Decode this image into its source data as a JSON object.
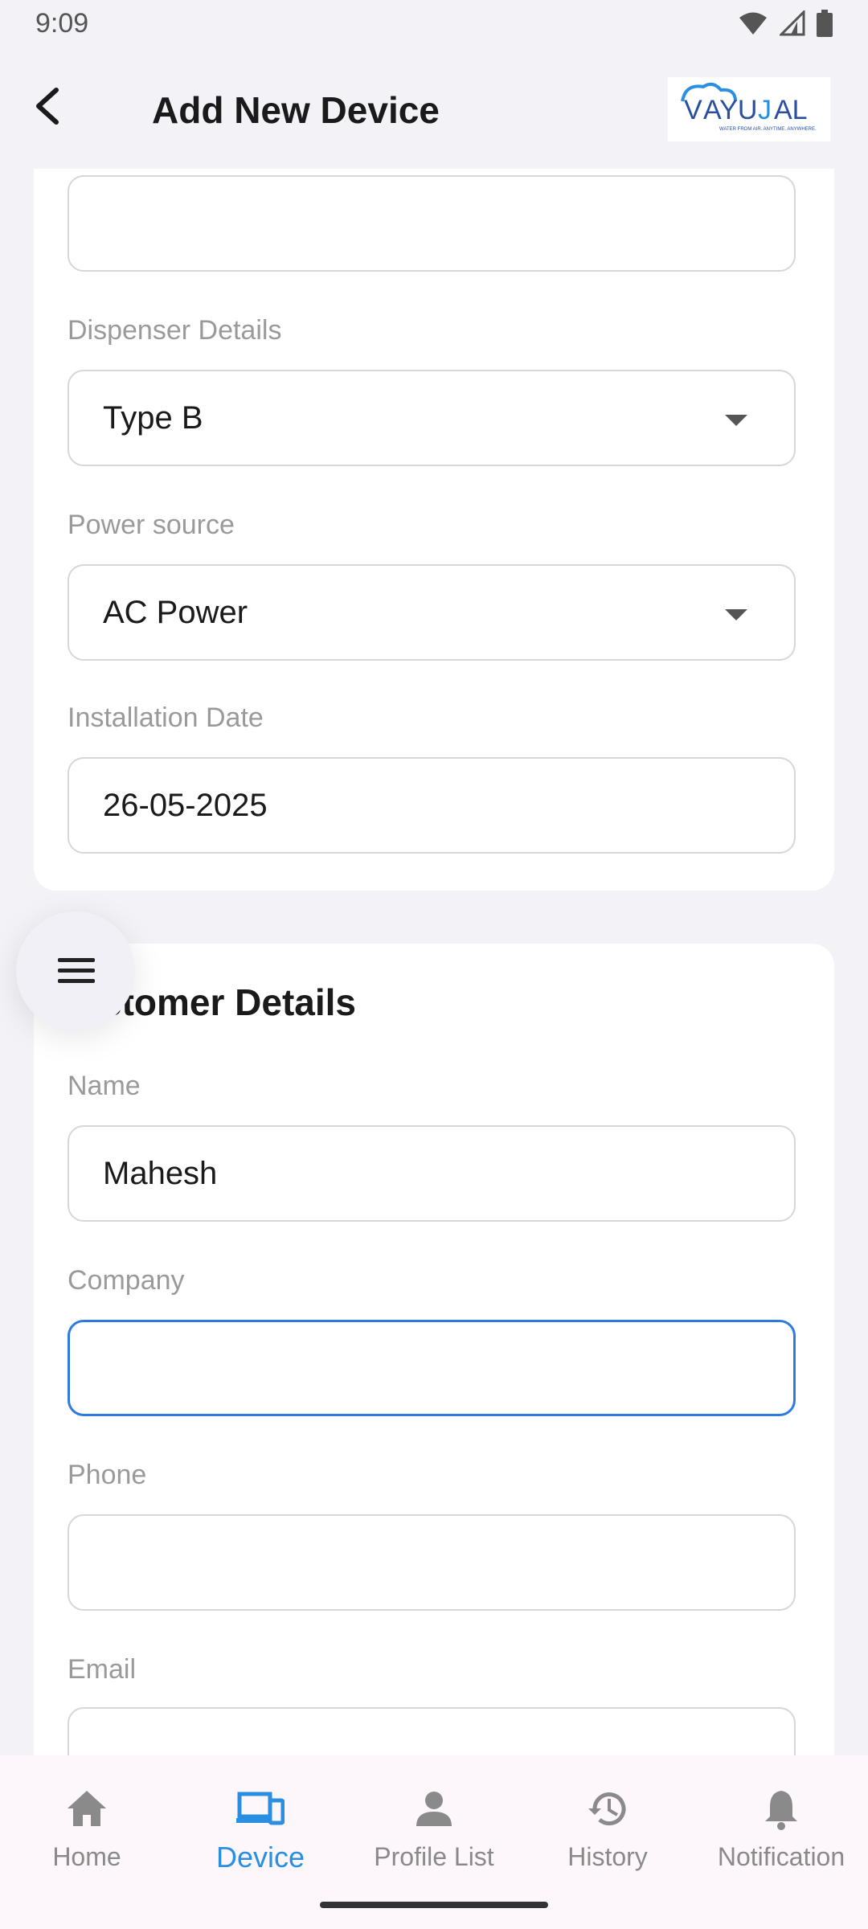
{
  "status_bar": {
    "time": "9:09"
  },
  "app_bar": {
    "title": "Add New Device",
    "logo_text": "VAYUJAL",
    "logo_tagline": "WATER FROM AIR. ANYTIME. ANYWHERE."
  },
  "device_details": {
    "fields": [
      {
        "label": "",
        "value": ""
      },
      {
        "label": "Dispenser Details",
        "value": "Type B"
      },
      {
        "label": "Power source",
        "value": "AC Power"
      },
      {
        "label": "Installation Date",
        "value": "26-05-2025"
      }
    ]
  },
  "customer_details": {
    "title": "Customer Details",
    "title_visible": "stomer Details",
    "fields": [
      {
        "label": "Name",
        "value": "Mahesh"
      },
      {
        "label": "Company",
        "value": ""
      },
      {
        "label": "Phone",
        "value": ""
      },
      {
        "label": "Email",
        "value": ""
      }
    ]
  },
  "bottom_nav": {
    "items": [
      {
        "label": "Home",
        "icon": "home-icon",
        "active": false
      },
      {
        "label": "Device",
        "icon": "devices-icon",
        "active": true
      },
      {
        "label": "Profile List",
        "icon": "person-icon",
        "active": false
      },
      {
        "label": "History",
        "icon": "history-icon",
        "active": false
      },
      {
        "label": "Notification",
        "icon": "bell-icon",
        "active": false
      }
    ]
  },
  "colors": {
    "accent": "#2a8fe0",
    "focus_border": "#2d7be0",
    "background": "#f2f2f7"
  }
}
